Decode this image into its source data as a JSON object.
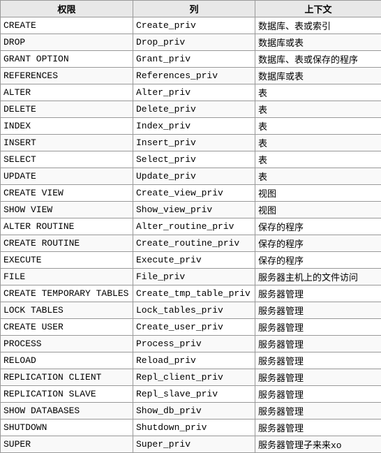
{
  "table": {
    "headers": [
      "权限",
      "列",
      "上下文"
    ],
    "rows": [
      [
        "CREATE",
        "Create_priv",
        "数据库、表或索引"
      ],
      [
        "DROP",
        "Drop_priv",
        "数据库或表"
      ],
      [
        "GRANT OPTION",
        "Grant_priv",
        "数据库、表或保存的程序"
      ],
      [
        "REFERENCES",
        "References_priv",
        "数据库或表"
      ],
      [
        "ALTER",
        "Alter_priv",
        "表"
      ],
      [
        "DELETE",
        "Delete_priv",
        "表"
      ],
      [
        "INDEX",
        "Index_priv",
        "表"
      ],
      [
        "INSERT",
        "Insert_priv",
        "表"
      ],
      [
        "SELECT",
        "Select_priv",
        "表"
      ],
      [
        "UPDATE",
        "Update_priv",
        "表"
      ],
      [
        "CREATE VIEW",
        "Create_view_priv",
        "视图"
      ],
      [
        "SHOW VIEW",
        "Show_view_priv",
        "视图"
      ],
      [
        "ALTER ROUTINE",
        "Alter_routine_priv",
        "保存的程序"
      ],
      [
        "CREATE ROUTINE",
        "Create_routine_priv",
        "保存的程序"
      ],
      [
        "EXECUTE",
        "Execute_priv",
        "保存的程序"
      ],
      [
        "FILE",
        "File_priv",
        "服务器主机上的文件访问"
      ],
      [
        "CREATE TEMPORARY TABLES",
        "Create_tmp_table_priv",
        "服务器管理"
      ],
      [
        "LOCK TABLES",
        "Lock_tables_priv",
        "服务器管理"
      ],
      [
        "CREATE USER",
        "Create_user_priv",
        "服务器管理"
      ],
      [
        "PROCESS",
        "Process_priv",
        "服务器管理"
      ],
      [
        "RELOAD",
        "Reload_priv",
        "服务器管理"
      ],
      [
        "REPLICATION CLIENT",
        "Repl_client_priv",
        "服务器管理"
      ],
      [
        "REPLICATION SLAVE",
        "Repl_slave_priv",
        "服务器管理"
      ],
      [
        "SHOW DATABASES",
        "Show_db_priv",
        "服务器管理"
      ],
      [
        "SHUTDOWN",
        "Shutdown_priv",
        "服务器管理"
      ],
      [
        "SUPER",
        "Super_priv",
        "服务器管理子来来xo"
      ]
    ]
  }
}
